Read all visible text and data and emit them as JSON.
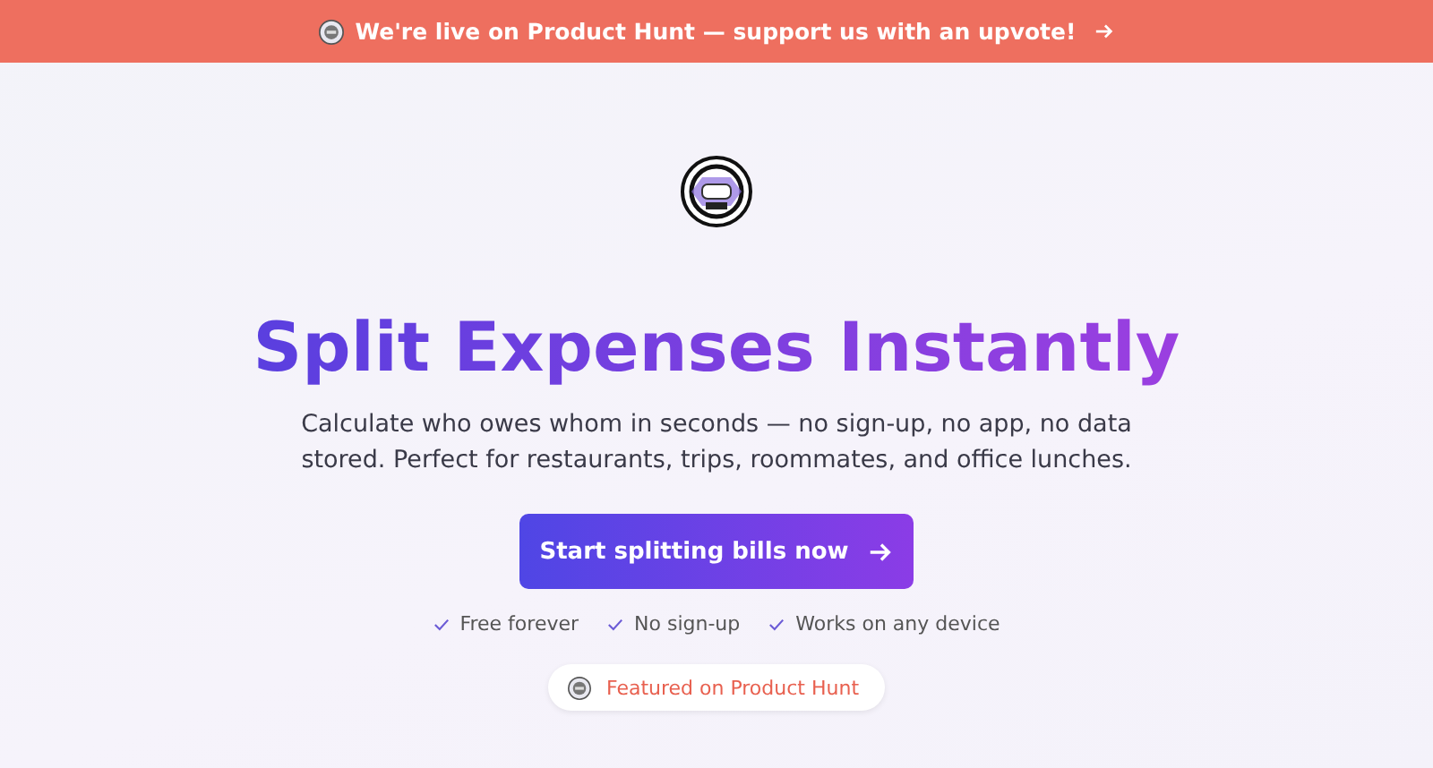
{
  "banner": {
    "text": "We're live on Product Hunt — support us with an upvote!"
  },
  "hero": {
    "title": "Split Expenses Instantly",
    "subtitle": "Calculate who owes whom in seconds — no sign-up, no app, no data stored. Perfect for restaurants, trips, roommates, and office lunches.",
    "cta": "Start splitting bills now",
    "features": [
      "Free forever",
      "No sign-up",
      "Works on any device"
    ],
    "featured_badge": "Featured on Product Hunt"
  }
}
